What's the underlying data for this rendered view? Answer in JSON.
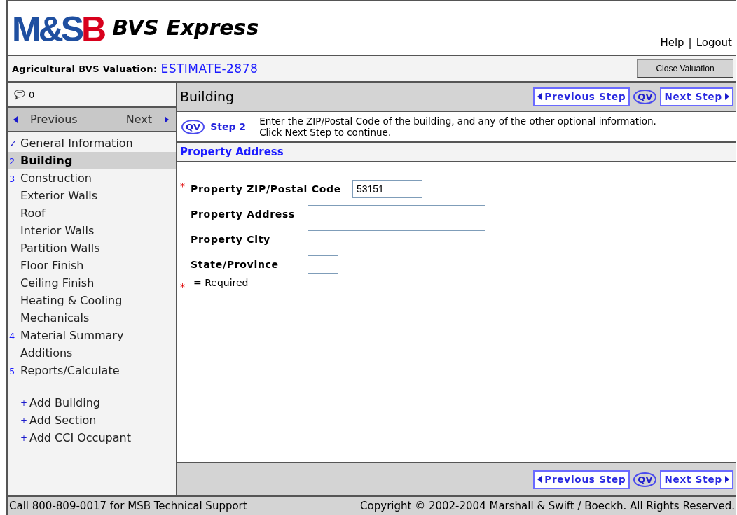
{
  "header": {
    "logo_parts": [
      {
        "text": "M&S",
        "color": "#1f4fa0"
      },
      {
        "text": "B",
        "color": "#d8001c"
      }
    ],
    "product": "BVS Express",
    "links": [
      "Help",
      "Logout"
    ],
    "link_separator": "|"
  },
  "title_bar": {
    "label": "Agricultural BVS Valuation:",
    "estimate": "ESTIMATE-2878",
    "close_button": "Close Valuation"
  },
  "sidebar": {
    "comment_count": "0",
    "previous": "Previous",
    "next": "Next",
    "items": [
      {
        "marker": "✓",
        "kind": "check",
        "label": "General Information",
        "selected": false
      },
      {
        "marker": "2",
        "kind": "number",
        "label": "Building",
        "selected": true
      },
      {
        "marker": "3",
        "kind": "number",
        "label": "Construction",
        "selected": false,
        "children": [
          {
            "label": "Exterior Walls",
            "selected": false
          },
          {
            "label": "Roof",
            "selected": false
          },
          {
            "label": "Interior Walls",
            "selected": false
          },
          {
            "label": "Partition Walls",
            "selected": false
          },
          {
            "label": "Floor Finish",
            "selected": false
          },
          {
            "label": "Ceiling Finish",
            "selected": false
          },
          {
            "label": "Heating & Cooling",
            "selected": false
          },
          {
            "label": "Mechanicals",
            "selected": false
          }
        ]
      },
      {
        "marker": "4",
        "kind": "number",
        "label": "Material Summary",
        "selected": false,
        "children": [
          {
            "label": "Additions",
            "selected": false
          }
        ]
      },
      {
        "marker": "5",
        "kind": "number",
        "label": "Reports/Calculate",
        "selected": false
      }
    ],
    "actions": [
      {
        "marker": "+",
        "label": "Add Building"
      },
      {
        "marker": "+",
        "label": "Add Section"
      },
      {
        "marker": "+",
        "label": "Add CCI Occupant"
      }
    ]
  },
  "main": {
    "title": "Building",
    "previous_step": "Previous Step",
    "qv": "QV",
    "next_step": "Next Step",
    "step": {
      "qv": "QV",
      "label": "Step 2",
      "instructions": "Enter the ZIP/Postal Code of the building, and any of the other optional information. Click Next Step to continue."
    },
    "section_title": "Property Address",
    "fields": [
      {
        "label": "Property ZIP/Postal Code",
        "required": true,
        "value": "53151"
      },
      {
        "label": "Property Address",
        "required": false
      },
      {
        "label": "Property City",
        "required": false
      },
      {
        "label": "State/Province",
        "required": false
      }
    ],
    "required_marker": "*",
    "required_note": "= Required",
    "bottom": {
      "previous_step": "Previous Step",
      "qv": "QV",
      "next_step": "Next Step"
    }
  },
  "status_bar": {
    "support": "Call 800-809-0017 for MSB Technical Support",
    "copyright": "Copyright © 2002-2004 Marshall & Swift / Boeckh. All Rights Reserved."
  }
}
